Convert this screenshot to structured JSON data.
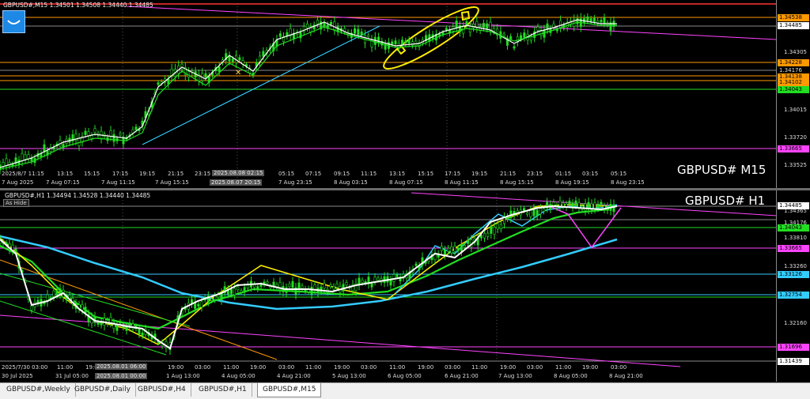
{
  "m15": {
    "info_line": "GBPUSD#,M15 1.34501 1.34508 1.34440 1.34485",
    "hide_label": "hide",
    "symbol_label": "GBPUSD# M15",
    "tags": [
      {
        "text": "1.34538",
        "color": "#ff9900"
      },
      {
        "text": "1.34485",
        "color": "#ffffff"
      },
      {
        "text": "1.34228",
        "color": "#ff9900"
      },
      {
        "text": "1.34176",
        "color": "#dddddd"
      },
      {
        "text": "1.34138",
        "color": "#ff9900"
      },
      {
        "text": "1.34102",
        "color": "#ff9900"
      },
      {
        "text": "1.34043",
        "color": "#22dd22"
      },
      {
        "text": "1.33665",
        "color": "#ff44ff"
      }
    ],
    "ticks": [
      "1.34305",
      "1.34015",
      "1.33720",
      "1.33525"
    ],
    "time_labels": [
      "7 Aug 2025",
      "2025/8/7 11:15",
      "13:15",
      "15:15",
      "17:15",
      "19:15",
      "21:15",
      "23:15",
      "05:15",
      "07:15",
      "09:15",
      "11:15",
      "13:15",
      "15:15",
      "17:15",
      "19:15",
      "21:15",
      "23:15",
      "01:15",
      "03:15",
      "05:15"
    ],
    "time_labels_lower": [
      "7 Aug 07:15",
      "7 Aug 11:15",
      "7 Aug 15:15",
      "7 Aug 23:15",
      "8 Aug 03:15",
      "8 Aug 07:15",
      "8 Aug 11:15",
      "8 Aug 15:15",
      "8 Aug 19:15",
      "8 Aug 23:15"
    ],
    "sel_time_1": "2025.08.08 02:15",
    "sel_time_2": "2025.08.07 20:15"
  },
  "h1": {
    "info_line": "GBPUSD#,H1 1.34494 1.34528 1.34440 1.34485",
    "hide_label": "As Hide",
    "symbol_label": "GBPUSD# H1",
    "tags": [
      {
        "text": "1.34485",
        "color": "#ffffff"
      },
      {
        "text": "1.34043",
        "color": "#22dd22"
      },
      {
        "text": "1.33665",
        "color": "#ff44ff"
      },
      {
        "text": "1.33126",
        "color": "#33ccff"
      },
      {
        "text": "1.32754",
        "color": "#33ccff"
      },
      {
        "text": "1.31696",
        "color": "#ff44ff"
      },
      {
        "text": "1.31439",
        "color": "#ffffff"
      }
    ],
    "ticks": [
      "1.34365",
      "1.34176",
      "1.33810",
      "1.33260",
      "1.32160"
    ],
    "time_labels": [
      "2025/7/30 03:00",
      "11:00",
      "19:00",
      "03:00",
      "11:00",
      "19:00",
      "03:00",
      "11:00",
      "19:00",
      "03:00",
      "11:00",
      "19:00",
      "03:00",
      "11:00",
      "19:00",
      "03:00",
      "11:00",
      "19:00",
      "03:00",
      "11:00",
      "19:00",
      "03:00",
      "11:00",
      "19:00",
      "03:00"
    ],
    "time_labels_lower": [
      "30 Jul 2025",
      "31 Jul 05:00",
      "1 Aug 13:00",
      "4 Aug 05:00",
      "4 Aug 21:00",
      "5 Aug 13:00",
      "6 Aug 05:00",
      "6 Aug 21:00",
      "7 Aug 13:00",
      "8 Aug 05:00",
      "8 Aug 21:00"
    ],
    "sel_time_1": "2025.08.01 06:00",
    "sel_time_2": "2025.08.01 00:00"
  },
  "tabs": [
    "GBPUSD#,Weekly",
    "GBPUSD#,Daily",
    "GBPUSD#,H4",
    "GBPUSD#,H1",
    "GBPUSD#,M15"
  ],
  "active_tab": "GBPUSD#,M15"
}
